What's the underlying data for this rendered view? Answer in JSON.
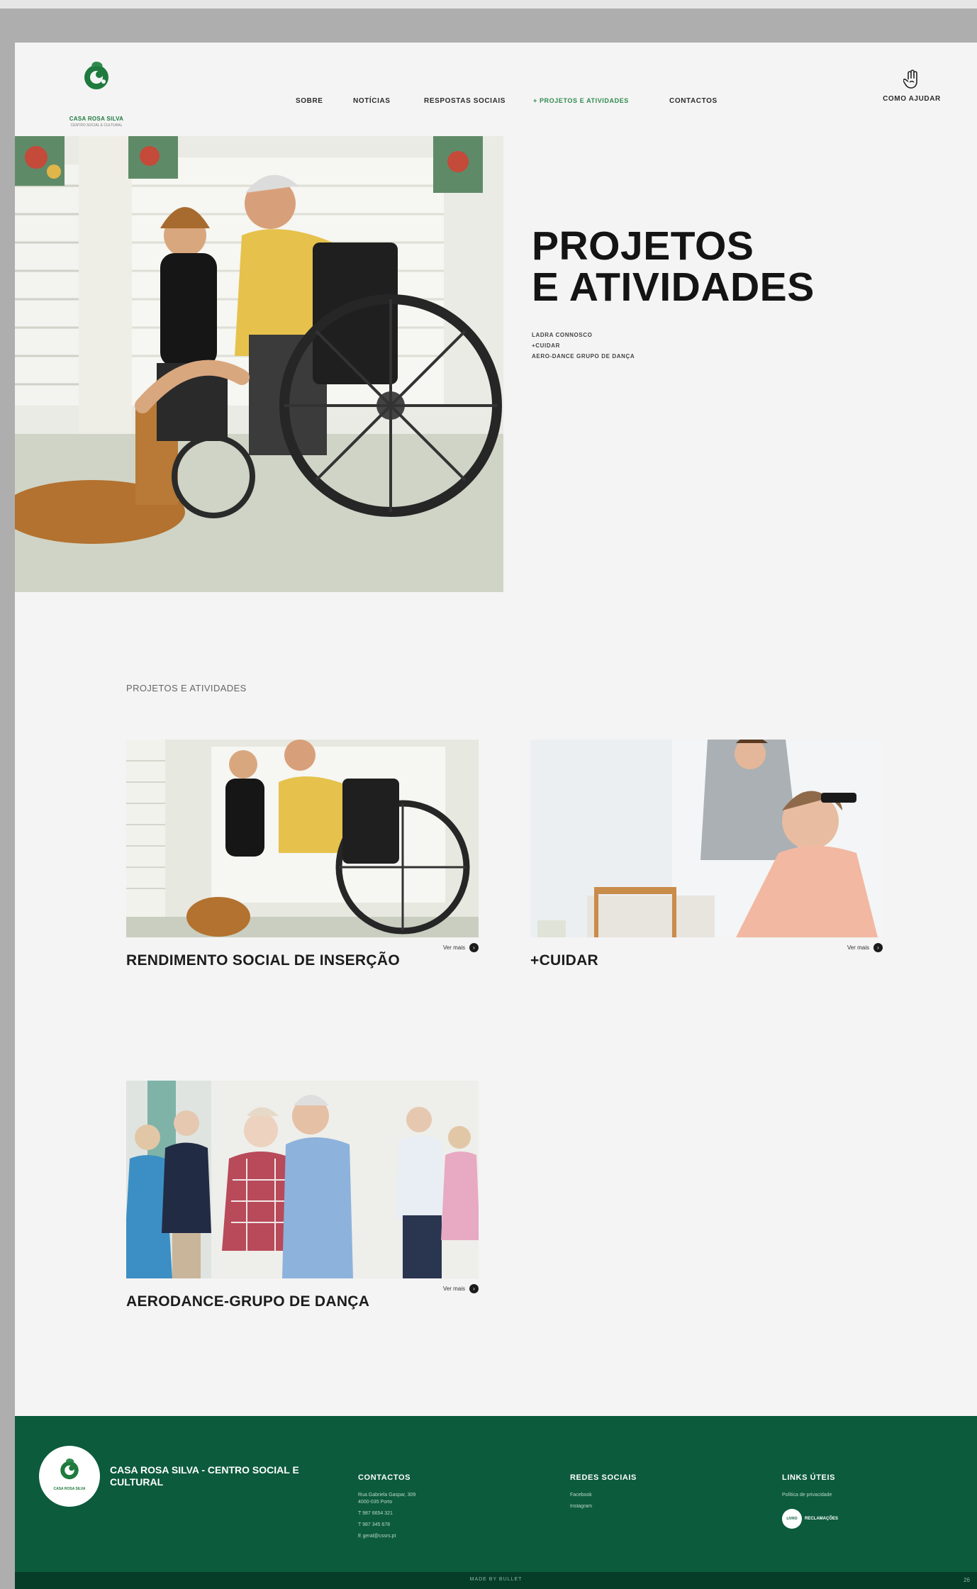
{
  "header": {
    "logo_name": "CASA ROSA SILVA",
    "logo_sub": "CENTRO SOCIAL E CULTURAL",
    "nav": [
      {
        "label": "SOBRE"
      },
      {
        "label": "NOTÍCIAS"
      },
      {
        "label": "RESPOSTAS SOCIAIS"
      },
      {
        "label": "+ PROJETOS E ATIVIDADES"
      },
      {
        "label": "CONTACTOS"
      }
    ],
    "help_label": "COMO AJUDAR"
  },
  "hero": {
    "title_line1": "PROJETOS",
    "title_line2": "E ATIVIDADES",
    "links": [
      "LADRA CONNOSCO",
      "+CUIDAR",
      "AERO-DANCE GRUPO DE DANÇA"
    ]
  },
  "section_label": "PROJETOS E ATIVIDADES",
  "cards": [
    {
      "title": "RENDIMENTO SOCIAL DE INSERÇÃO",
      "more": "Ver mais",
      "arrow": "›"
    },
    {
      "title": "+CUIDAR",
      "more": "Ver mais",
      "arrow": "›"
    },
    {
      "title": "AERODANCE-GRUPO DE DANÇA",
      "more": "Ver mais",
      "arrow": "›"
    }
  ],
  "footer": {
    "logo_name": "CASA ROSA SILVA",
    "org": "CASA ROSA SILVA - CENTRO SOCIAL E CULTURAL",
    "contacts": {
      "heading": "CONTACTOS",
      "address1": "Rua Gabriela Gaspar, 309",
      "address2": "4000-035 Porto",
      "phone1": "T 987 6654 321",
      "phone2": "T 987 345 678",
      "email": "E geral@cssrs.pt"
    },
    "social": {
      "heading": "REDES SOCIAIS",
      "links": [
        "Facebook",
        "Instagram"
      ]
    },
    "useful": {
      "heading": "LINKS ÚTEIS",
      "link": "Política de privacidade",
      "badge_logo": "LIVRO",
      "badge_text": "RECLAMAÇÕES"
    },
    "copyright": "MADE BY BULLET",
    "page_num": "26"
  },
  "colors": {
    "brand_green": "#0c5b3c",
    "accent_green": "#2f8a4e"
  }
}
